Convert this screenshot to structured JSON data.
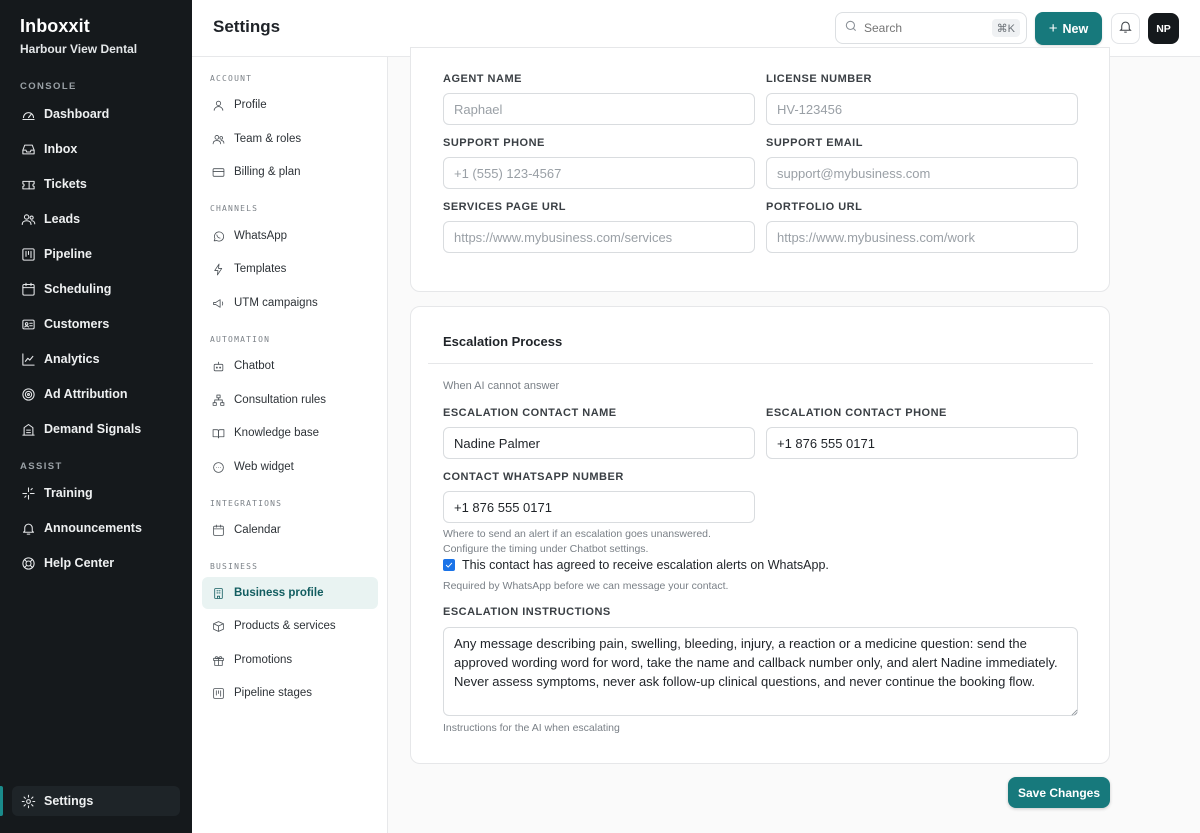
{
  "app": {
    "name": "Inboxxit",
    "workspace": "Harbour View Dental"
  },
  "sidebar": {
    "sections": [
      {
        "title": "CONSOLE",
        "items": [
          {
            "label": "Dashboard",
            "icon": "gauge-icon"
          },
          {
            "label": "Inbox",
            "icon": "inbox-icon"
          },
          {
            "label": "Tickets",
            "icon": "ticket-icon"
          },
          {
            "label": "Leads",
            "icon": "users-icon"
          },
          {
            "label": "Pipeline",
            "icon": "kanban-icon"
          },
          {
            "label": "Scheduling",
            "icon": "calendar-icon"
          },
          {
            "label": "Customers",
            "icon": "id-card-icon"
          },
          {
            "label": "Analytics",
            "icon": "chart-line-icon"
          },
          {
            "label": "Ad Attribution",
            "icon": "target-icon"
          },
          {
            "label": "Demand Signals",
            "icon": "building-icon"
          }
        ]
      },
      {
        "title": "ASSIST",
        "items": [
          {
            "label": "Training",
            "icon": "sparkle-icon"
          },
          {
            "label": "Announcements",
            "icon": "bell-icon"
          },
          {
            "label": "Help Center",
            "icon": "lifebuoy-icon"
          }
        ]
      }
    ],
    "settings_label": "Settings"
  },
  "header": {
    "title": "Settings",
    "search_placeholder": "Search",
    "search_shortcut": "⌘K",
    "new_label": "New",
    "avatar_initials": "NP"
  },
  "subnav": {
    "sections": [
      {
        "title": "ACCOUNT",
        "items": [
          {
            "label": "Profile",
            "icon": "user-icon"
          },
          {
            "label": "Team & roles",
            "icon": "team-icon"
          },
          {
            "label": "Billing & plan",
            "icon": "credit-card-icon"
          }
        ]
      },
      {
        "title": "CHANNELS",
        "items": [
          {
            "label": "WhatsApp",
            "icon": "whatsapp-icon"
          },
          {
            "label": "Templates",
            "icon": "bolt-icon"
          },
          {
            "label": "UTM campaigns",
            "icon": "megaphone-icon"
          }
        ]
      },
      {
        "title": "AUTOMATION",
        "items": [
          {
            "label": "Chatbot",
            "icon": "bot-icon"
          },
          {
            "label": "Consultation rules",
            "icon": "flow-icon"
          },
          {
            "label": "Knowledge base",
            "icon": "book-icon"
          },
          {
            "label": "Web widget",
            "icon": "chat-icon"
          }
        ]
      },
      {
        "title": "INTEGRATIONS",
        "items": [
          {
            "label": "Calendar",
            "icon": "calendar-icon"
          }
        ]
      },
      {
        "title": "BUSINESS",
        "items": [
          {
            "label": "Business profile",
            "icon": "building-icon",
            "active": true
          },
          {
            "label": "Products & services",
            "icon": "box-icon"
          },
          {
            "label": "Promotions",
            "icon": "gift-icon"
          },
          {
            "label": "Pipeline stages",
            "icon": "kanban-icon"
          }
        ]
      }
    ]
  },
  "business_fields": {
    "agent_name": {
      "label": "AGENT NAME",
      "value": "",
      "placeholder": "Raphael"
    },
    "license_number": {
      "label": "LICENSE NUMBER",
      "value": "",
      "placeholder": "HV-123456"
    },
    "support_phone": {
      "label": "SUPPORT PHONE",
      "value": "",
      "placeholder": "+1 (555) 123-4567"
    },
    "support_email": {
      "label": "SUPPORT EMAIL",
      "value": "",
      "placeholder": "support@mybusiness.com"
    },
    "services_url": {
      "label": "SERVICES PAGE URL",
      "value": "",
      "placeholder": "https://www.mybusiness.com/services"
    },
    "portfolio_url": {
      "label": "PORTFOLIO URL",
      "value": "",
      "placeholder": "https://www.mybusiness.com/work"
    }
  },
  "escalation": {
    "title": "Escalation Process",
    "subtitle": "When AI cannot answer",
    "contact_name": {
      "label": "ESCALATION CONTACT NAME",
      "value": "Nadine Palmer"
    },
    "contact_phone": {
      "label": "ESCALATION CONTACT PHONE",
      "value": "+1 876 555 0171"
    },
    "whatsapp_number": {
      "label": "CONTACT WHATSAPP NUMBER",
      "value": "+1 876 555 0171"
    },
    "whatsapp_hint_1": "Where to send an alert if an escalation goes unanswered.",
    "whatsapp_hint_2": "Configure the timing under Chatbot settings.",
    "consent_label": "This contact has agreed to receive escalation alerts on WhatsApp.",
    "consent_checked": true,
    "consent_hint": "Required by WhatsApp before we can message your contact.",
    "instructions": {
      "label": "ESCALATION INSTRUCTIONS",
      "value": "Any message describing pain, swelling, bleeding, injury, a reaction or a medicine question: send the approved wording word for word, take the name and callback number only, and alert Nadine immediately. Never assess symptoms, never ask follow-up clinical questions, and never continue the booking flow.",
      "hint": "Instructions for the AI when escalating"
    }
  },
  "save_label": "Save Changes",
  "colors": {
    "accent": "#17797c",
    "sidebar_bg": "#15191c",
    "active_nav_bg": "#e9f3f2"
  }
}
